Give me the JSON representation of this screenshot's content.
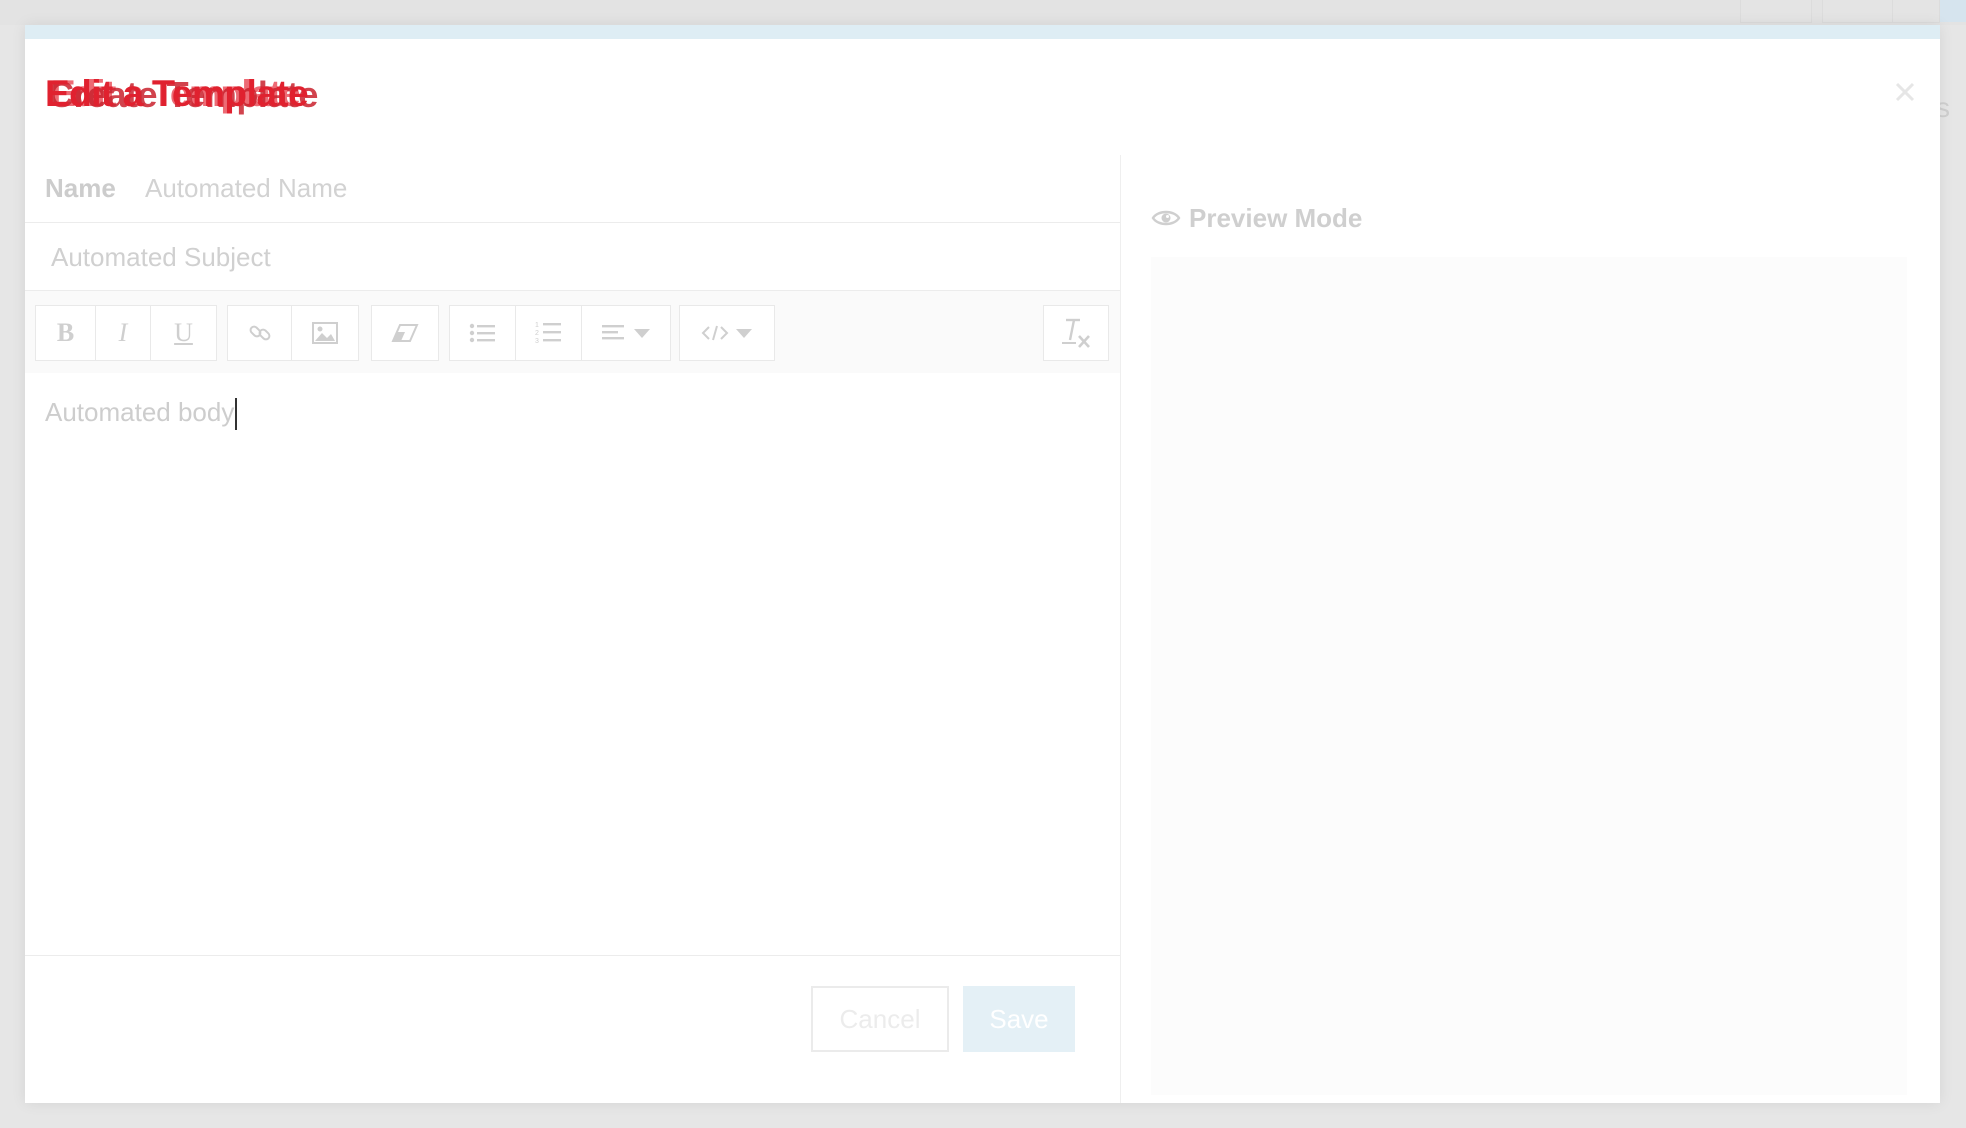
{
  "modal": {
    "title": "Edit a Template",
    "title_ghost": "Create Template",
    "title_ghost2": "Edit a Template"
  },
  "form": {
    "name_label": "Name",
    "name_value": "Automated Name",
    "subject_value": "Automated Subject",
    "body_text": "Automated body"
  },
  "toolbar": {
    "bold_label": "B",
    "italic_label": "I",
    "underline_label": "U"
  },
  "footer": {
    "cancel_label": "Cancel",
    "save_label": "Save"
  },
  "preview": {
    "label": "Preview Mode"
  },
  "backdrop": {
    "edge_letter": "s"
  },
  "colors": {
    "title": "#e0212f",
    "save_bg": "#e4f0f6",
    "top_strip": "#deedf4"
  }
}
